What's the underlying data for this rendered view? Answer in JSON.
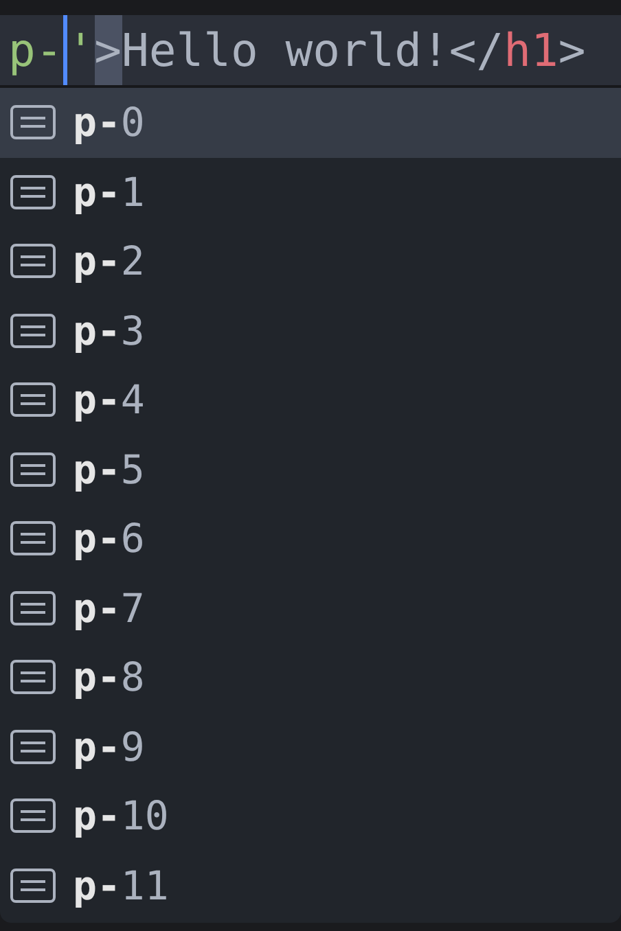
{
  "editor_line": [
    {
      "kind": "string",
      "text": "p-",
      "highlighted": false
    },
    {
      "kind": "cursor"
    },
    {
      "kind": "string",
      "text": "'",
      "highlighted": false
    },
    {
      "kind": "plain",
      "text": ">",
      "highlighted": true
    },
    {
      "kind": "plain",
      "text": "Hello world!</",
      "highlighted": false
    },
    {
      "kind": "tag",
      "text": "h1",
      "highlighted": false
    },
    {
      "kind": "plain",
      "text": ">",
      "highlighted": false
    }
  ],
  "completions": [
    {
      "match": "p-",
      "rest": "0",
      "selected": true
    },
    {
      "match": "p-",
      "rest": "1",
      "selected": false
    },
    {
      "match": "p-",
      "rest": "2",
      "selected": false
    },
    {
      "match": "p-",
      "rest": "3",
      "selected": false
    },
    {
      "match": "p-",
      "rest": "4",
      "selected": false
    },
    {
      "match": "p-",
      "rest": "5",
      "selected": false
    },
    {
      "match": "p-",
      "rest": "6",
      "selected": false
    },
    {
      "match": "p-",
      "rest": "7",
      "selected": false
    },
    {
      "match": "p-",
      "rest": "8",
      "selected": false
    },
    {
      "match": "p-",
      "rest": "9",
      "selected": false
    },
    {
      "match": "p-",
      "rest": "10",
      "selected": false
    },
    {
      "match": "p-",
      "rest": "11",
      "selected": false
    }
  ]
}
